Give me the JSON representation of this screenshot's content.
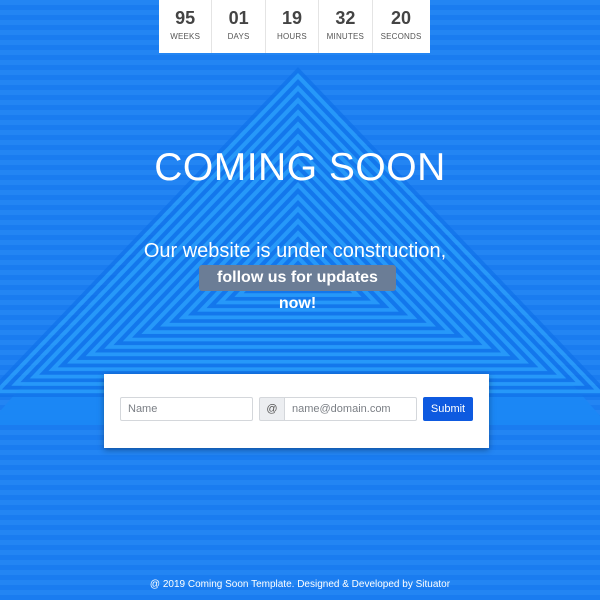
{
  "colors": {
    "background": "#1a7cf0",
    "accent_button": "#0e5ae0",
    "highlight_badge": "#6b7d96"
  },
  "countdown": [
    {
      "value": "95",
      "label": "WEEKS"
    },
    {
      "value": "01",
      "label": "DAYS"
    },
    {
      "value": "19",
      "label": "HOURS"
    },
    {
      "value": "32",
      "label": "MINUTES"
    },
    {
      "value": "20",
      "label": "SECONDS"
    }
  ],
  "hero": {
    "title": "COMING SOON",
    "subtitle": "Our website is under construction,",
    "highlight": "follow us for updates now!"
  },
  "form": {
    "name_placeholder": "Name",
    "at_symbol": "@",
    "email_placeholder": "name@domain.com",
    "submit_label": "Submit"
  },
  "footer": {
    "text": "@ 2019 Coming Soon Template. Designed & Developed by Situator"
  }
}
